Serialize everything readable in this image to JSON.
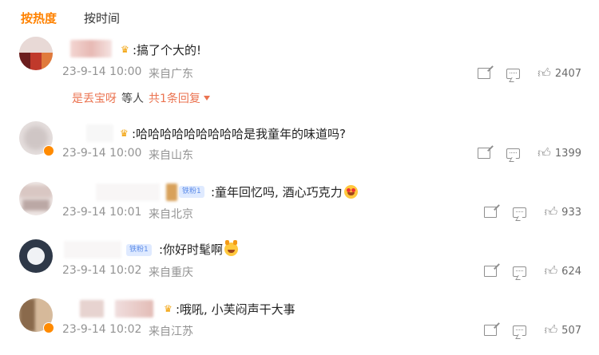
{
  "tabs": {
    "hot": "按热度",
    "time": "按时间"
  },
  "reply_summary": {
    "user": "是丢宝呀",
    "middle": "等人",
    "count": "共1条回复"
  },
  "comments": [
    {
      "text": ":搞了个大的!",
      "timestamp": "23-9-14 10:00",
      "location": "来自广东",
      "likes": "2407"
    },
    {
      "text": ":哈哈哈哈哈哈哈哈哈是我童年的味道吗?",
      "timestamp": "23-9-14 10:00",
      "location": "来自山东",
      "likes": "1399"
    },
    {
      "text": ":童年回忆吗, 酒心巧克力",
      "badge": "铁粉1",
      "timestamp": "23-9-14 10:01",
      "location": "来自北京",
      "likes": "933"
    },
    {
      "text": ":你好时髦啊",
      "badge": "铁粉1",
      "timestamp": "23-9-14 10:02",
      "location": "来自重庆",
      "likes": "624"
    },
    {
      "text": ":哦吼, 小芙闷声干大事",
      "timestamp": "23-9-14 10:02",
      "location": "来自江苏",
      "likes": "507"
    }
  ],
  "icons": {
    "share": "share-icon",
    "comment": "comment-icon",
    "like": "thumbs-up-icon",
    "vip": "crown-icon"
  },
  "colors": {
    "accent": "#ff8200",
    "reply_link": "#eb7350",
    "meta": "#939393"
  }
}
